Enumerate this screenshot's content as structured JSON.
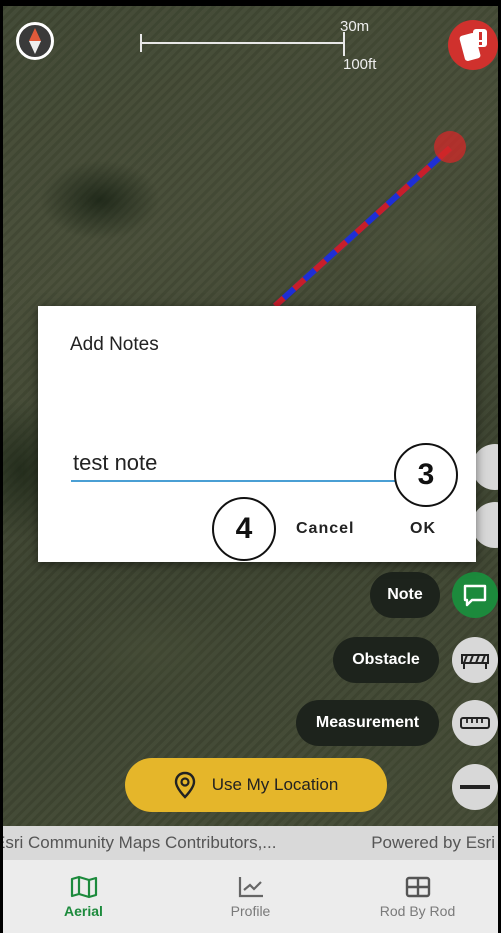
{
  "scale": {
    "metric": "30m",
    "imperial": "100ft"
  },
  "dialog": {
    "title": "Add Notes",
    "note_value": "test note",
    "cancel_label": "Cancel",
    "ok_label": "OK"
  },
  "callouts": {
    "ok": "3",
    "cancel": "4"
  },
  "tools": {
    "note_label": "Note",
    "obstacle_label": "Obstacle",
    "measurement_label": "Measurement"
  },
  "locate_label": "Use My Location",
  "attribution": {
    "left": "Esri Community Maps Contributors,...",
    "right": "Powered by Esri"
  },
  "nav": [
    {
      "label": "Aerial",
      "icon": "map-icon",
      "active": true
    },
    {
      "label": "Profile",
      "icon": "chart-icon",
      "active": false
    },
    {
      "label": "Rod By Rod",
      "icon": "table-icon",
      "active": false
    }
  ],
  "colors": {
    "accent_green": "#1c8a3c",
    "locate_yellow": "#e5b62a",
    "alert_red": "#d0312d",
    "input_underline": "#4a9fd4"
  }
}
